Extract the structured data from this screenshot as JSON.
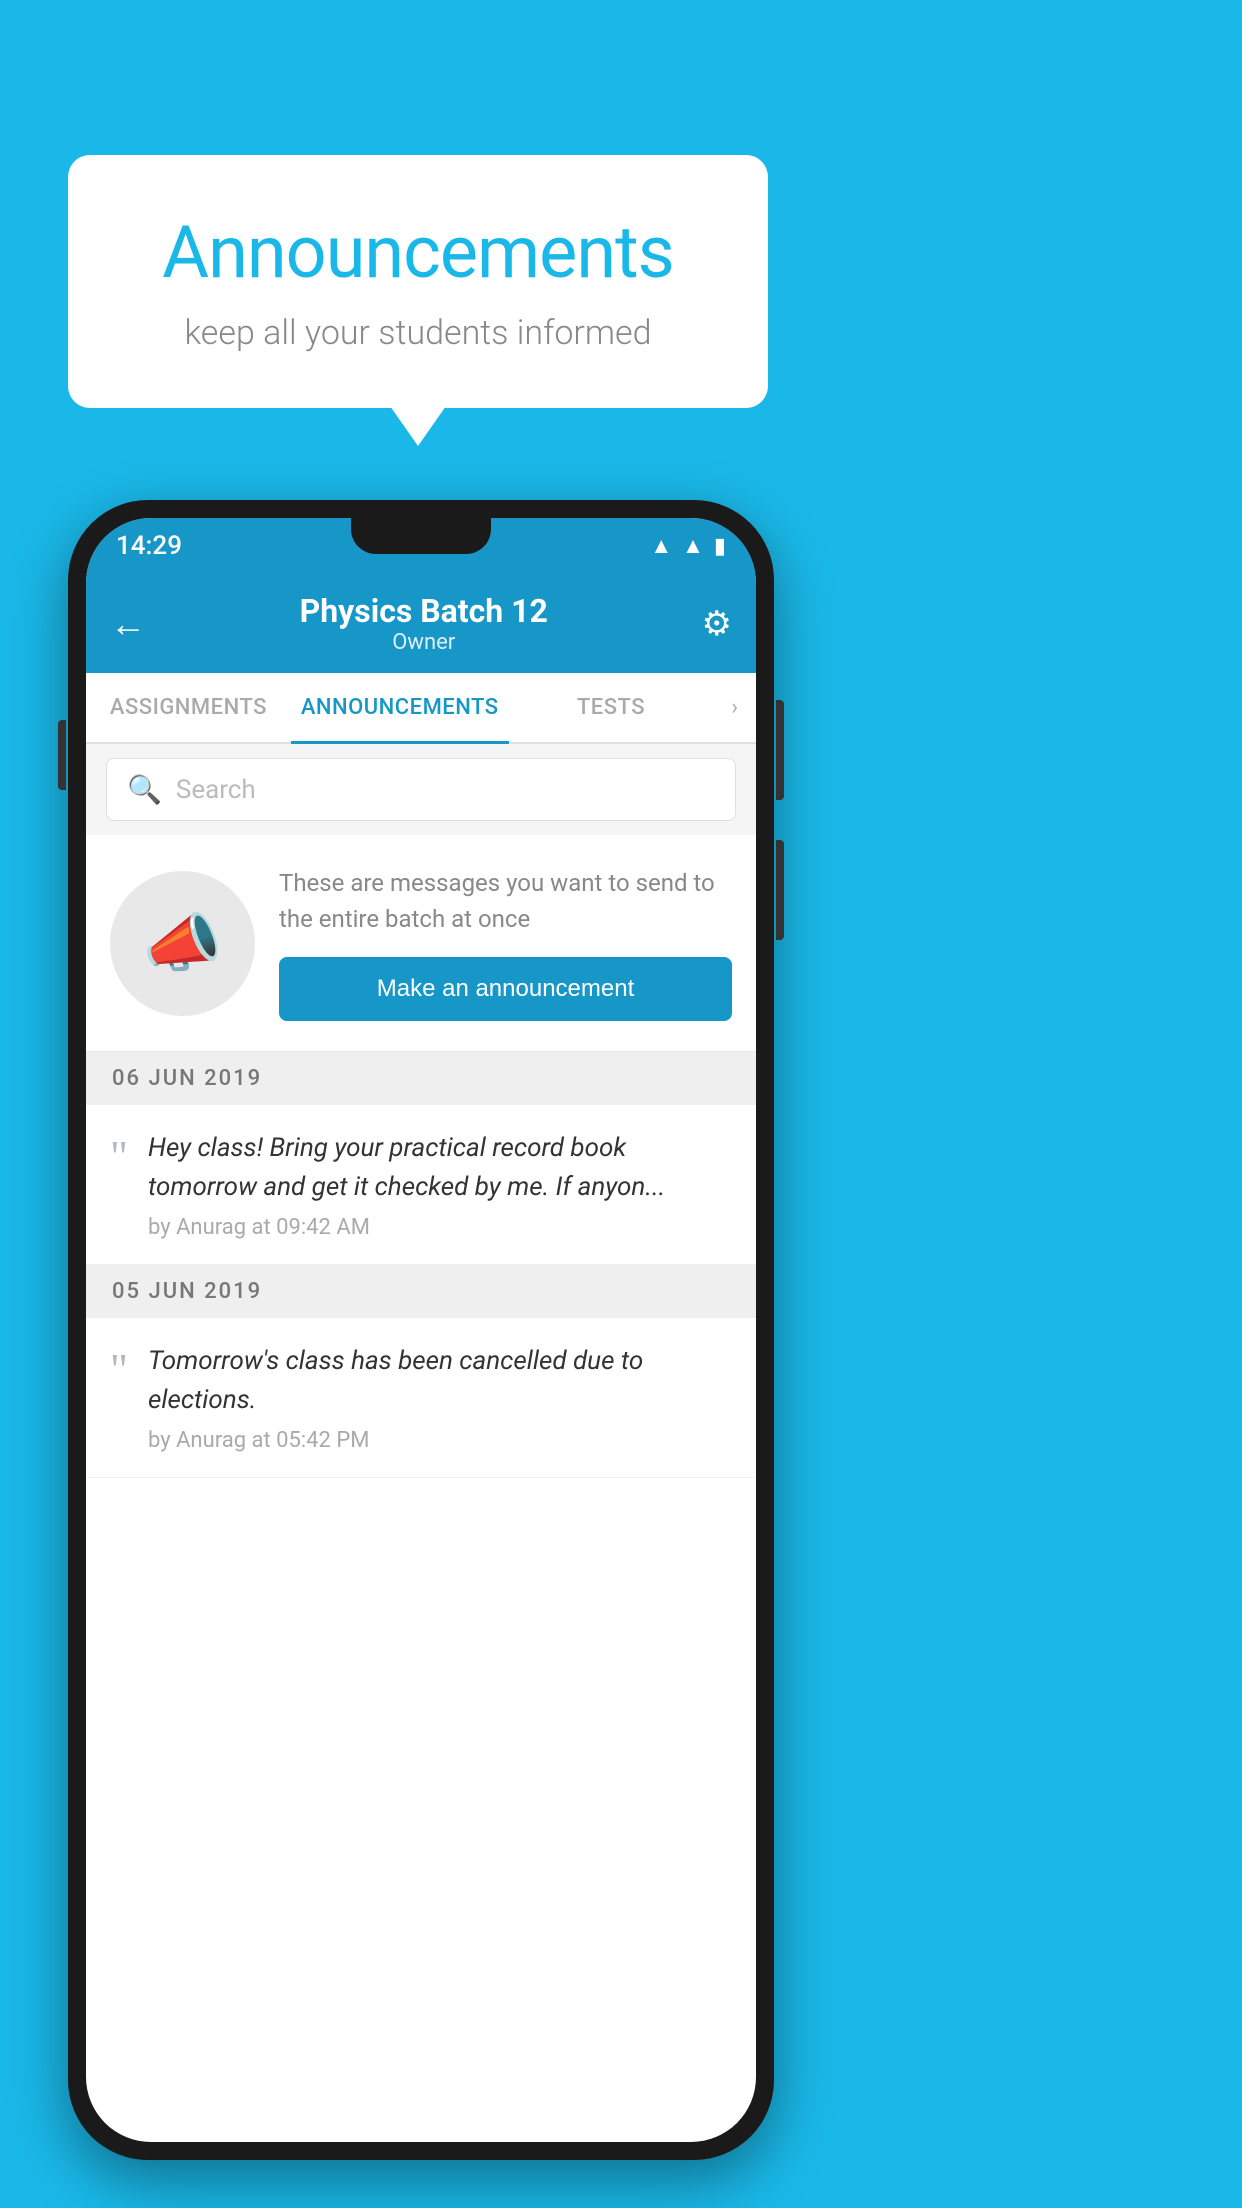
{
  "background_color": "#1ab8e8",
  "speech_bubble": {
    "title": "Announcements",
    "subtitle": "keep all your students informed"
  },
  "phone": {
    "status_bar": {
      "time": "14:29",
      "icons": [
        "wifi",
        "signal",
        "battery"
      ]
    },
    "header": {
      "back_label": "←",
      "batch_name": "Physics Batch 12",
      "owner_label": "Owner",
      "settings_icon": "⚙"
    },
    "tabs": [
      {
        "label": "ASSIGNMENTS",
        "active": false
      },
      {
        "label": "ANNOUNCEMENTS",
        "active": true
      },
      {
        "label": "TESTS",
        "active": false
      }
    ],
    "search": {
      "placeholder": "Search"
    },
    "announcement_prompt": {
      "description": "These are messages you want to send to the entire batch at once",
      "button_label": "Make an announcement"
    },
    "announcements": [
      {
        "date": "06  JUN  2019",
        "message": "Hey class! Bring your practical record book tomorrow and get it checked by me. If anyon...",
        "meta": "by Anurag at 09:42 AM"
      },
      {
        "date": "05  JUN  2019",
        "message": "Tomorrow's class has been cancelled due to elections.",
        "meta": "by Anurag at 05:42 PM"
      }
    ]
  }
}
